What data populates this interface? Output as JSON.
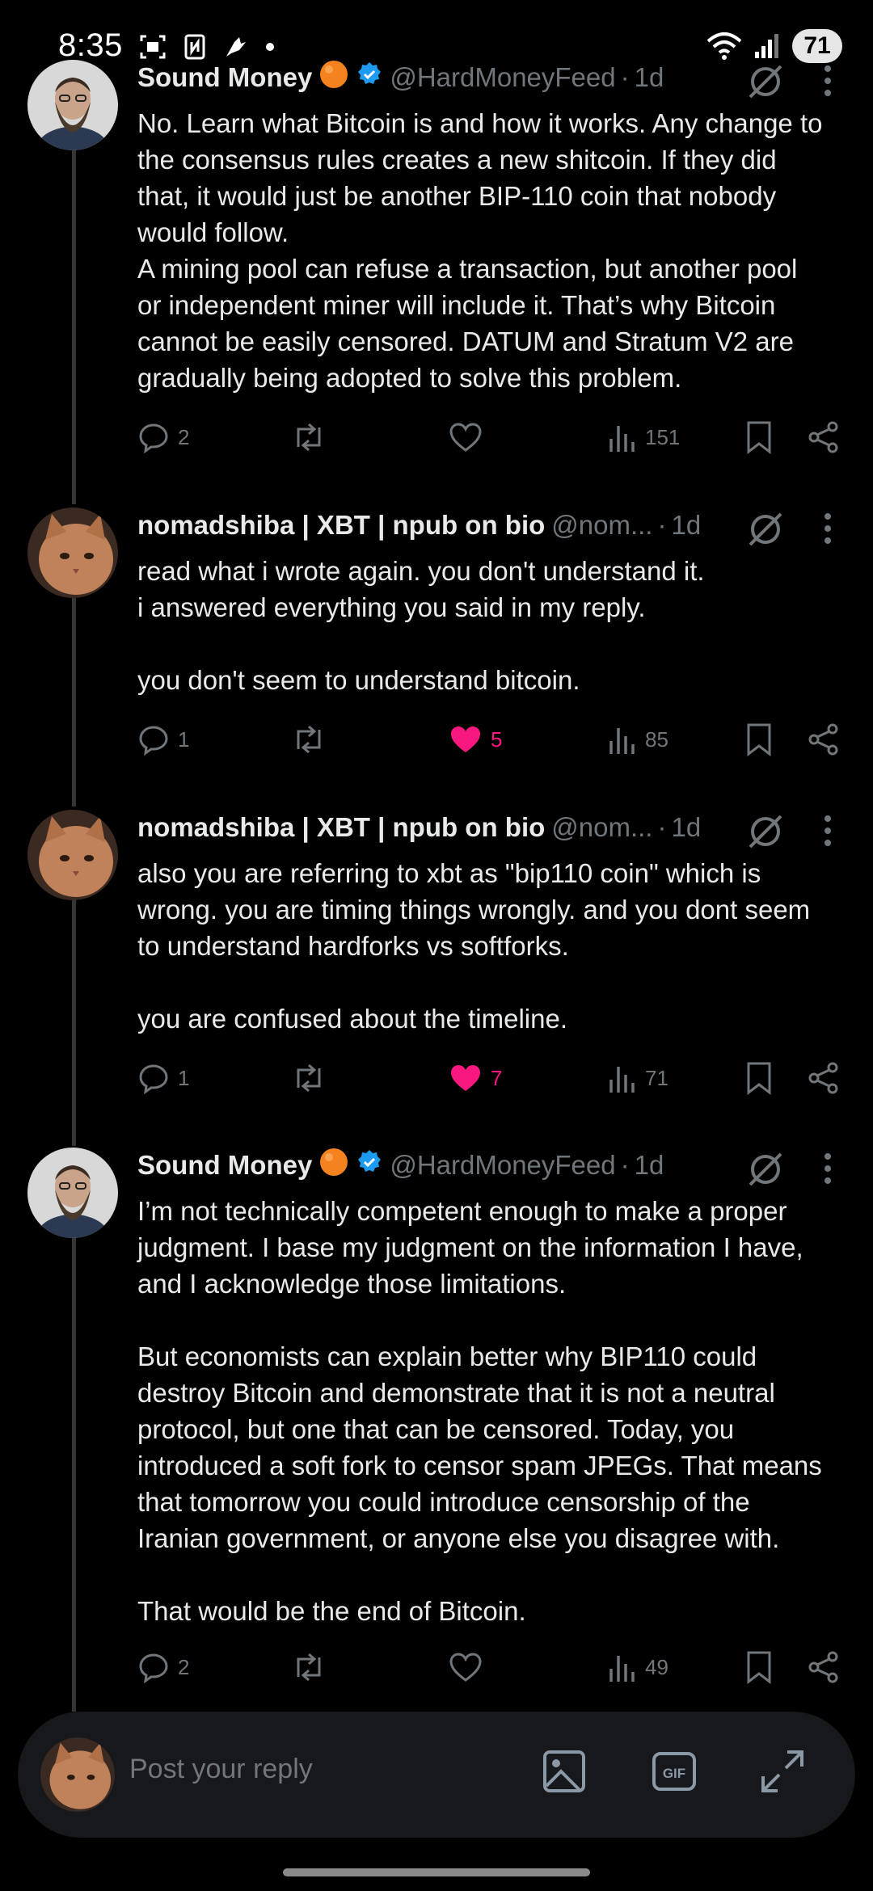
{
  "status_bar": {
    "time": "8:35",
    "battery": "71"
  },
  "posts": [
    {
      "avatar": "bearded-man-portrait",
      "name": "Sound Money",
      "emoji": "orange-circle",
      "verified": true,
      "handle": "@HardMoneyFeed",
      "time": "1d",
      "body": [
        "No. Learn what Bitcoin is and how it works. Any change to",
        "the consensus rules creates a new shitcoin. If they did",
        "that, it would just be another BIP-110 coin that nobody",
        "would follow.",
        "A mining pool can refuse a transaction, but another pool",
        "or independent miner will include it. That’s why Bitcoin",
        "cannot be easily censored. DATUM and Stratum V2 are",
        "gradually being adopted to solve this problem."
      ],
      "replies": "2",
      "reposts": "",
      "likes": "",
      "liked": false,
      "views": "151"
    },
    {
      "avatar": "cat-photo",
      "name": "nomadshiba | XBT | npub on bio",
      "emoji": "",
      "verified": false,
      "handle": "@nom...",
      "time": "1d",
      "body": [
        "read what i wrote again. you don't understand it.",
        "i answered everything you said in my reply.",
        "",
        "you don't seem to understand bitcoin."
      ],
      "replies": "1",
      "reposts": "",
      "likes": "5",
      "liked": true,
      "views": "85"
    },
    {
      "avatar": "cat-photo",
      "name": "nomadshiba | XBT | npub on bio",
      "emoji": "",
      "verified": false,
      "handle": "@nom...",
      "time": "1d",
      "body": [
        "also you are referring to xbt as \"bip110 coin\" which is",
        "wrong. you are timing things wrongly. and you dont seem",
        "to understand hardforks vs softforks.",
        "",
        "you are confused about the timeline."
      ],
      "replies": "1",
      "reposts": "",
      "likes": "7",
      "liked": true,
      "views": "71"
    },
    {
      "avatar": "bearded-man-portrait",
      "name": "Sound Money",
      "emoji": "orange-circle",
      "verified": true,
      "handle": "@HardMoneyFeed",
      "time": "1d",
      "body": [
        "I’m not technically competent enough to make a proper",
        "judgment. I base my judgment on the information I have,",
        "and I acknowledge those limitations.",
        "",
        "But economists can explain better why BIP110 could",
        "destroy Bitcoin and demonstrate that it is not a neutral",
        "protocol, but one that can be censored. Today, you",
        "introduced a soft fork to censor spam JPEGs. That means",
        "that tomorrow you could introduce censorship of the",
        "Iranian government, or anyone else you disagree with.",
        "",
        "That would be the end of Bitcoin."
      ],
      "replies": "2",
      "reposts": "",
      "likes": "",
      "liked": false,
      "views": "49"
    }
  ],
  "reply_bar": {
    "placeholder": "Post your reply",
    "icons": [
      "image-icon",
      "gif-icon",
      "expand-icon"
    ]
  },
  "colors": {
    "background": "#000000",
    "text": "#e7e9ea",
    "muted": "#71767b",
    "like": "#f91880",
    "verified": "#1d9bf0"
  }
}
